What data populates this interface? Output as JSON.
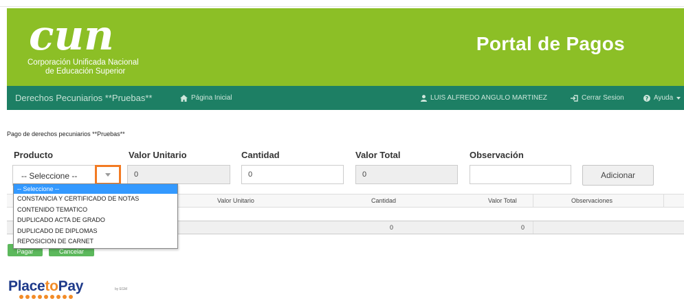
{
  "header": {
    "logo_script": "cun",
    "logo_line1": "Corporación Unificada Nacional",
    "logo_line2": "de Educación Superior",
    "title": "Portal de Pagos",
    "banner_color": "#8cbf26"
  },
  "navbar": {
    "brand": "Derechos Pecuniarios **Pruebas**",
    "home": "Página Inicial",
    "user": "LUIS ALFREDO ANGULO MARTINEZ",
    "logout": "Cerrar Sesion",
    "help": "Ayuda",
    "color": "#1d7f64",
    "icons": {
      "home": "home-icon",
      "user": "user-icon",
      "logout": "sign-out-icon",
      "help": "help-circle-icon",
      "caret": "caret-down-icon"
    }
  },
  "form": {
    "heading": "Pago de derechos pecuniarios **Pruebas**",
    "producto_label": "Producto",
    "valor_unitario_label": "Valor Unitario",
    "cantidad_label": "Cantidad",
    "valor_total_label": "Valor Total",
    "observacion_label": "Observación",
    "producto_selected": "-- Seleccione --",
    "valor_unitario_value": "0",
    "cantidad_value": "0",
    "valor_total_value": "0",
    "observacion_value": "",
    "add_button": "Adicionar",
    "dropdown_toggle_highlight": "#f27a22",
    "dropdown_options": [
      "-- Seleccione --",
      "CONSTANCIA Y CERTIFICADO DE NOTAS",
      "CONTENIDO TEMATICO",
      "DUPLICADO ACTA DE GRADO",
      "DUPLICADO DE DIPLOMAS",
      "REPOSICION DE CARNET"
    ]
  },
  "table": {
    "columns": [
      "Valor Unitario",
      "Cantidad",
      "Valor Total",
      "Observaciones"
    ],
    "totals": {
      "cantidad": "0",
      "valor_total": "0"
    }
  },
  "actions": {
    "pay": "Pagar",
    "cancel": "Cancelar",
    "button_color": "#5cb85c"
  },
  "footer": {
    "logo_place": "Place",
    "logo_to": "to",
    "logo_pay": "Pay",
    "logo_by": "by EGM"
  }
}
